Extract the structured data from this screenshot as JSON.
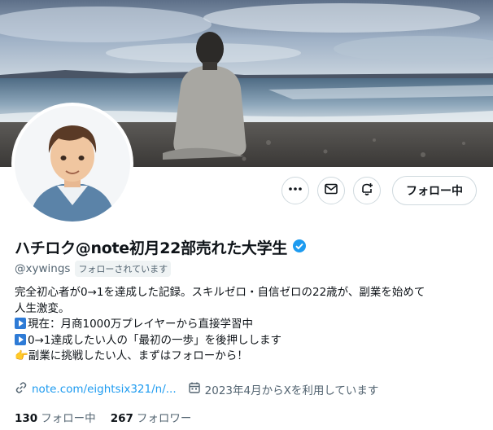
{
  "profile": {
    "display_name": "ハチロク@note初月22部売れた大学生",
    "handle": "@xywings",
    "follows_you": "フォローされています",
    "bio_lines": [
      "完全初心者が0→1を達成した記録。スキルゼロ・自信ゼロの22歳が、副業を始めて",
      "人生激変。",
      "現在：月商1000万プレイヤーから直接学習中",
      "0→1達成したい人の「最初の一歩」を後押しします",
      "👉副業に挑戦したい人、まずはフォローから！"
    ],
    "link": "note.com/eightsix321/n/...",
    "joined": "2023年4月からXを利用しています",
    "following_count": "130",
    "following_label": "フォロー中",
    "followers_count": "267",
    "followers_label": "フォロワー"
  },
  "actions": {
    "more_icon": "more-icon",
    "message_icon": "mail-icon",
    "notify_icon": "bell-plus-icon",
    "follow_label": "フォロー中"
  },
  "colors": {
    "link": "#1d9bf0",
    "verified": "#1d9bf0",
    "muted": "#536471",
    "border": "#cfd9de"
  }
}
